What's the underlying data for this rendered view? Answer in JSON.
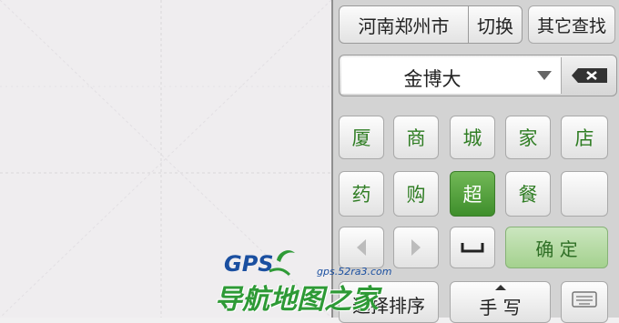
{
  "header": {
    "city": "河南郑州市",
    "switch_label": "切换",
    "other_search_label": "其它查找"
  },
  "search": {
    "value": "金博大"
  },
  "keyboard": {
    "row1": [
      "厦",
      "商",
      "城",
      "家",
      "店"
    ],
    "row2": [
      "药",
      "购",
      "超",
      "餐",
      ""
    ],
    "active_key": "超",
    "confirm_label": "确  定",
    "sort_label": "选择排序",
    "handwrite_label": "手 写"
  },
  "watermark": {
    "brand": "GPS",
    "url": "gps.52ra3.com",
    "slogan": "导航地图之家"
  },
  "colors": {
    "key_text": "#2f7d23",
    "active_key": "#4f9f37",
    "confirm_bg": "#b3da9f",
    "watermark_blue": "#1a4fa0",
    "watermark_green": "#2e9a36"
  }
}
